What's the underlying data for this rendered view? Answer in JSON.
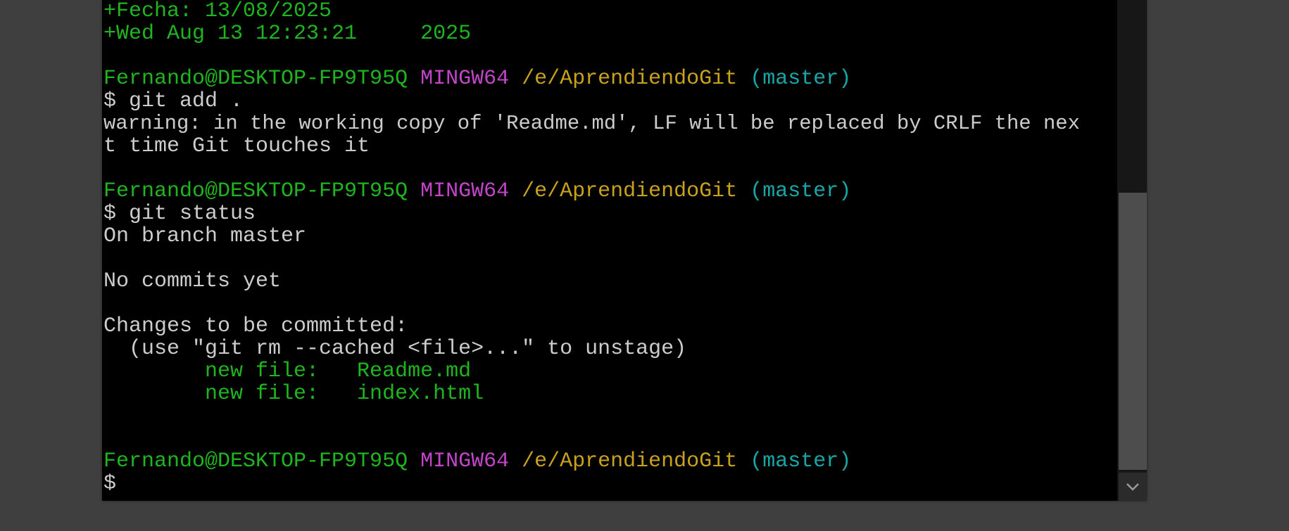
{
  "terminal": {
    "lines": [
      {
        "segments": [
          {
            "text": "+Fecha: 13/08/2025",
            "color": "green"
          }
        ]
      },
      {
        "segments": [
          {
            "text": "+Wed Aug 13 12:23:21     2025",
            "color": "green"
          }
        ]
      },
      {
        "segments": []
      },
      {
        "segments": [
          {
            "text": "Fernando@DESKTOP-FP9T95Q",
            "color": "green"
          },
          {
            "text": " ",
            "color": "white"
          },
          {
            "text": "MINGW64",
            "color": "magenta"
          },
          {
            "text": " ",
            "color": "white"
          },
          {
            "text": "/e/AprendiendoGit",
            "color": "yellow"
          },
          {
            "text": " ",
            "color": "white"
          },
          {
            "text": "(master)",
            "color": "cyan"
          }
        ]
      },
      {
        "segments": [
          {
            "text": "$ git add .",
            "color": "white"
          }
        ]
      },
      {
        "wide": true,
        "segments": [
          {
            "text": "warning: in the working copy of 'Readme.md', LF will be replaced by CRLF the nex",
            "color": "white"
          }
        ]
      },
      {
        "segments": [
          {
            "text": "t time Git touches it",
            "color": "white"
          }
        ]
      },
      {
        "segments": []
      },
      {
        "segments": [
          {
            "text": "Fernando@DESKTOP-FP9T95Q",
            "color": "green"
          },
          {
            "text": " ",
            "color": "white"
          },
          {
            "text": "MINGW64",
            "color": "magenta"
          },
          {
            "text": " ",
            "color": "white"
          },
          {
            "text": "/e/AprendiendoGit",
            "color": "yellow"
          },
          {
            "text": " ",
            "color": "white"
          },
          {
            "text": "(master)",
            "color": "cyan"
          }
        ]
      },
      {
        "segments": [
          {
            "text": "$ git status",
            "color": "white"
          }
        ]
      },
      {
        "segments": [
          {
            "text": "On branch master",
            "color": "white"
          }
        ]
      },
      {
        "segments": []
      },
      {
        "segments": [
          {
            "text": "No commits yet",
            "color": "white"
          }
        ]
      },
      {
        "segments": []
      },
      {
        "segments": [
          {
            "text": "Changes to be committed:",
            "color": "white"
          }
        ]
      },
      {
        "segments": [
          {
            "text": "  (use \"git rm --cached <file>...\" to unstage)",
            "color": "white"
          }
        ]
      },
      {
        "segments": [
          {
            "text": "        new file:   Readme.md",
            "color": "green"
          }
        ]
      },
      {
        "segments": [
          {
            "text": "        new file:   index.html",
            "color": "green"
          }
        ]
      },
      {
        "segments": []
      },
      {
        "segments": []
      },
      {
        "segments": [
          {
            "text": "Fernando@DESKTOP-FP9T95Q",
            "color": "green"
          },
          {
            "text": " ",
            "color": "white"
          },
          {
            "text": "MINGW64",
            "color": "magenta"
          },
          {
            "text": " ",
            "color": "white"
          },
          {
            "text": "/e/AprendiendoGit",
            "color": "yellow"
          },
          {
            "text": " ",
            "color": "white"
          },
          {
            "text": "(master)",
            "color": "cyan"
          }
        ]
      },
      {
        "segments": [
          {
            "text": "$",
            "color": "white"
          }
        ]
      }
    ]
  },
  "colors": {
    "background": "#000000",
    "white": "#cccccc",
    "green": "#1fb51f",
    "magenta": "#c244c9",
    "yellow": "#c9a21c",
    "cyan": "#19a6a6"
  },
  "scrollbar": {
    "down_icon": "chevron-down-icon"
  }
}
